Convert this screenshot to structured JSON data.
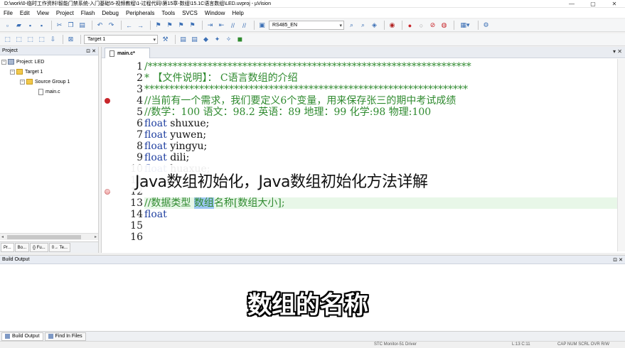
{
  "window": {
    "title": "D:\\work\\0-临时工作资料\\智能门禁系统-入门基础\\5-视频教程\\1-过程代码\\第15章-数组\\15.1C语言数组\\LED.uvproj - µVision",
    "controls": [
      "—",
      "▢",
      "✕"
    ]
  },
  "menu": [
    "File",
    "Edit",
    "View",
    "Project",
    "Flash",
    "Debug",
    "Peripherals",
    "Tools",
    "SVCS",
    "Window",
    "Help"
  ],
  "toolbar": {
    "device_combo": "RS485_EN",
    "target_label": "Target 1"
  },
  "project_panel": {
    "title": "Project",
    "pin": "⊡",
    "close": "✕",
    "tree": [
      {
        "label": "Project: LED",
        "level": 0,
        "kind": "project",
        "exp": "−"
      },
      {
        "label": "Target 1",
        "level": 1,
        "kind": "folder",
        "exp": "−"
      },
      {
        "label": "Source Group 1",
        "level": 2,
        "kind": "folder",
        "exp": "−"
      },
      {
        "label": "main.c",
        "level": 3,
        "kind": "file",
        "exp": ""
      }
    ],
    "tabs": [
      "Pr...",
      "Bo...",
      "{} Fu...",
      "0→ Te..."
    ]
  },
  "editor": {
    "tab_label": "main.c*",
    "lines": [
      {
        "n": "1",
        "parts": [
          {
            "t": "/*****************************************************************",
            "c": "cm"
          }
        ]
      },
      {
        "n": "2",
        "parts": [
          {
            "t": "* 【文件说明】： C语言数组的介绍",
            "c": "cm"
          }
        ]
      },
      {
        "n": "3",
        "parts": [
          {
            "t": "*****************************************************************",
            "c": "cm"
          }
        ]
      },
      {
        "n": "4",
        "bp": "red",
        "parts": [
          {
            "t": "//当前有一个需求，我们要定义6个变量，用来保存张三的期中考试成绩",
            "c": "cm"
          }
        ]
      },
      {
        "n": "5",
        "parts": [
          {
            "t": "//数学：100 语文：98.2 英语：89 地理：99 化学:98 物理:100",
            "c": "cm"
          }
        ]
      },
      {
        "n": "6",
        "parts": [
          {
            "t": "float",
            "c": "kw"
          },
          {
            "t": " shuxue;",
            "c": "tx"
          }
        ]
      },
      {
        "n": "7",
        "parts": [
          {
            "t": "float",
            "c": "kw"
          },
          {
            "t": " yuwen;",
            "c": "tx"
          }
        ]
      },
      {
        "n": "8",
        "parts": [
          {
            "t": "float",
            "c": "kw"
          },
          {
            "t": " yingyu;",
            "c": "tx"
          }
        ]
      },
      {
        "n": "9",
        "parts": [
          {
            "t": "float",
            "c": "kw"
          },
          {
            "t": " dili;",
            "c": "tx"
          }
        ]
      },
      {
        "n": "10",
        "parts": [
          {
            "t": "float",
            "c": "kw"
          },
          {
            "t": " huaxue;",
            "c": "tx"
          }
        ]
      },
      {
        "n": "11",
        "parts": []
      },
      {
        "n": "12",
        "bp": "pink",
        "parts": []
      },
      {
        "n": "13",
        "current": true,
        "parts": [
          {
            "t": "//数据类型  ",
            "c": "cm"
          },
          {
            "t": "数组",
            "c": "hl"
          },
          {
            "t": "名称[数组大小];",
            "c": "cm"
          }
        ]
      },
      {
        "n": "14",
        "parts": [
          {
            "t": "float",
            "c": "kw"
          }
        ]
      },
      {
        "n": "15",
        "parts": []
      },
      {
        "n": "16",
        "parts": []
      }
    ]
  },
  "build_output": {
    "title": "Build Output",
    "pin": "⊡",
    "close": "✕"
  },
  "bottom_tabs": [
    "Build Output",
    "Find In Files"
  ],
  "status": {
    "debugger": "STC Monitor-51 Driver",
    "position": "L:13 C:11",
    "flags": "CAP  NUM  SCRL  OVR  R/W"
  },
  "overlay_title": "Java数组初始化，Java数组初始化方法详解",
  "caption": "数组的名称"
}
